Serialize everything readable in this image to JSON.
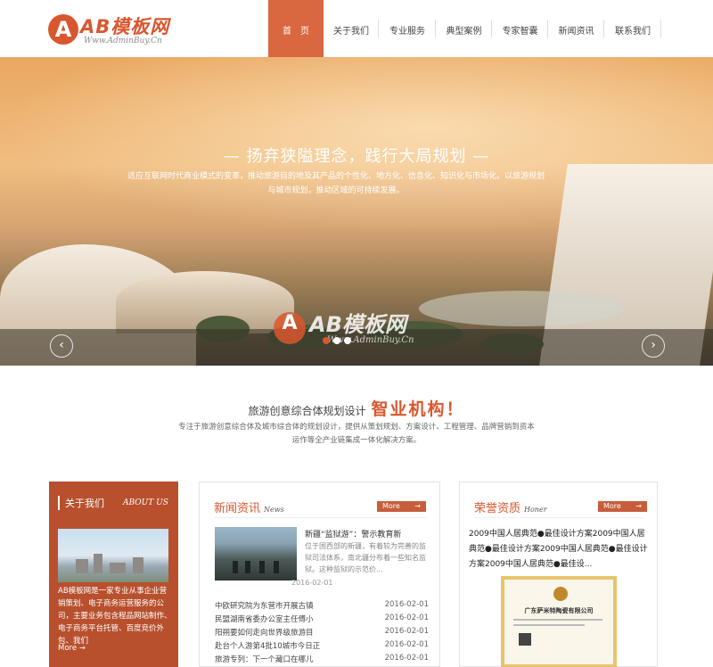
{
  "header": {
    "logo_badge": "A",
    "logo_title": "AB模板网",
    "logo_sub": "Www.AdminBuy.Cn",
    "nav": [
      {
        "label": "首　页",
        "active": true
      },
      {
        "label": "关于我们",
        "active": false
      },
      {
        "label": "专业服务",
        "active": false
      },
      {
        "label": "典型案例",
        "active": false
      },
      {
        "label": "专家智囊",
        "active": false
      },
      {
        "label": "新闻资讯",
        "active": false
      },
      {
        "label": "联系我们",
        "active": false
      }
    ]
  },
  "banner": {
    "slogan": "— 扬弃狭隘理念，践行大局规划 —",
    "description": "适应互联网时代商业模式的变革，推动旅游目的地及其产品的个性化、地方化、信息化、知识化与市场化，以旅游规划与城市规划，推动区域的可持续发展。",
    "prev_arrow": "‹",
    "next_arrow": "›",
    "watermark_badge": "A",
    "watermark_title": "AB模板网",
    "watermark_sub": "Www.AdminBuy.Cn"
  },
  "intro": {
    "title_a": "旅游创意综合体规划设计",
    "title_b": "智业机构！",
    "description": "专注于旅游创意综合体及城市综合体的规划设计，提供从策划规划、方案设计、工程管理、品牌营销到资本运作等全产业链集成一体化解决方案。"
  },
  "about": {
    "title": "关于我们",
    "title_en": "ABOUT US",
    "text": "AB模板网是一家专业从事企业营销策划、电子商务运营服务的公司，主要业务包含程品网站制作、电子商务平台托管、百度竞价外包、我们",
    "more": "More →"
  },
  "news": {
    "title": "新闻资讯",
    "title_en": "News",
    "more": "More",
    "featured": {
      "title": "新疆“监狱游”：警示教育新",
      "desc": "位于国西部的新疆，有着较为完善的监狱司法体系，南北疆分布着一些知名监狱。这种监狱的示范价...",
      "date": "2016-02-01"
    },
    "items": [
      {
        "title": "中欧研究院为东营市开展古镇",
        "date": "2016-02-01"
      },
      {
        "title": "民盟湖南省委办公室主任傅小",
        "date": "2016-02-01"
      },
      {
        "title": "阳朔要如何走向世界级旅游目",
        "date": "2016-02-01"
      },
      {
        "title": "赴台个人游第4批10城市今日正",
        "date": "2016-02-01"
      },
      {
        "title": "旅游专列：下一个藏口在哪儿",
        "date": "2016-02-01"
      }
    ]
  },
  "honor": {
    "title": "荣誉资质",
    "title_en": "Honer",
    "more": "More",
    "text": "2009中国人居典范●最佳设计方案2009中国人居典范●最佳设计方案2009中国人居典范●最佳设计方案2009中国人居典范●最佳设...",
    "cert_title": "广东萨米特陶瓷有限公司"
  },
  "colors": {
    "accent": "#d9572f",
    "nav_active": "#d9673f",
    "about_bg": "#b8502e",
    "more_btn": "#c75d3a"
  }
}
